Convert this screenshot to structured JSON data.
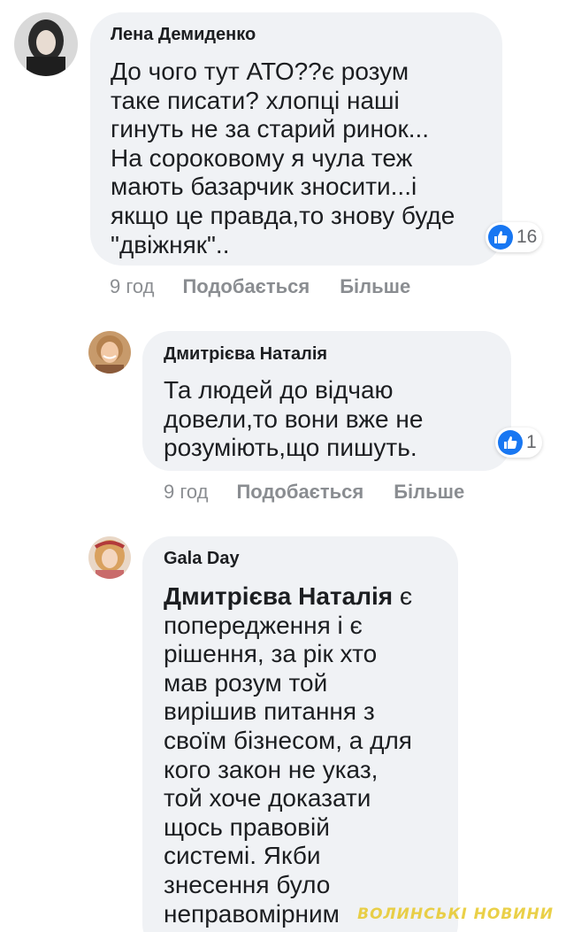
{
  "comments": [
    {
      "author": "Лена Демиденко",
      "text": "До чого тут АТО??є розум\nтаке писати? хлопці наші\nгинуть не за старий ринок...\nНа сороковому я чула теж\nмають базарчик зносити...і\nякщо це правда,то знову буде\n\"двіжняк\"..",
      "reaction_count": "16",
      "time": "9 год",
      "like_label": "Подобається",
      "more_label": "Більше"
    },
    {
      "author": "Дмитрієва Наталія",
      "text": "Та людей до відчаю\nдовели,то вони вже не\nрозуміють,що пишуть.",
      "reaction_count": "1",
      "time": "9 год",
      "like_label": "Подобається",
      "more_label": "Більше"
    },
    {
      "author": "Gala Day",
      "mention": "Дмитрієва Наталія",
      "text": " є\nпопередження і є\nрішення, за рік хто\nмав розум той\nвирішив питання з\nсвоїм бізнесом, а для\nкого закон не указ,\nтой хоче доказати\nщось правовій\nсистемі. Якби\nзнесення було\nнеправомірним\nвикликали б поліцію. А"
    }
  ],
  "watermark": "ВОЛИНСЬКІ НОВИНИ",
  "colors": {
    "bubble": "#f0f2f5",
    "like_blue": "#1877f2",
    "meta_gray": "#8a8d91"
  },
  "icons": {
    "reaction": "like-thumb-icon"
  }
}
